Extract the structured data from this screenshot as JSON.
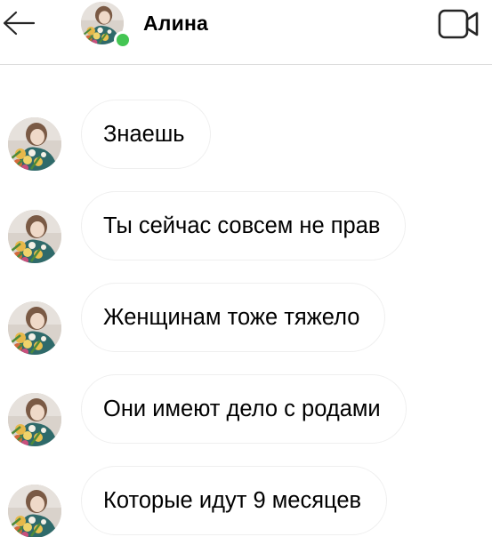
{
  "header": {
    "contact_name": "Алина",
    "online": true
  },
  "messages": [
    {
      "text": "Знаешь"
    },
    {
      "text": "Ты сейчас совсем не прав"
    },
    {
      "text": "Женщинам тоже тяжело"
    },
    {
      "text": "Они имеют дело с родами"
    },
    {
      "text": "Которые идут 9 месяцев"
    }
  ],
  "colors": {
    "online_indicator": "#44c553",
    "divider": "#dbdbdb",
    "bubble_border": "#efefef"
  },
  "icons": {
    "back": "arrow-left-icon",
    "video_call": "video-camera-icon"
  }
}
